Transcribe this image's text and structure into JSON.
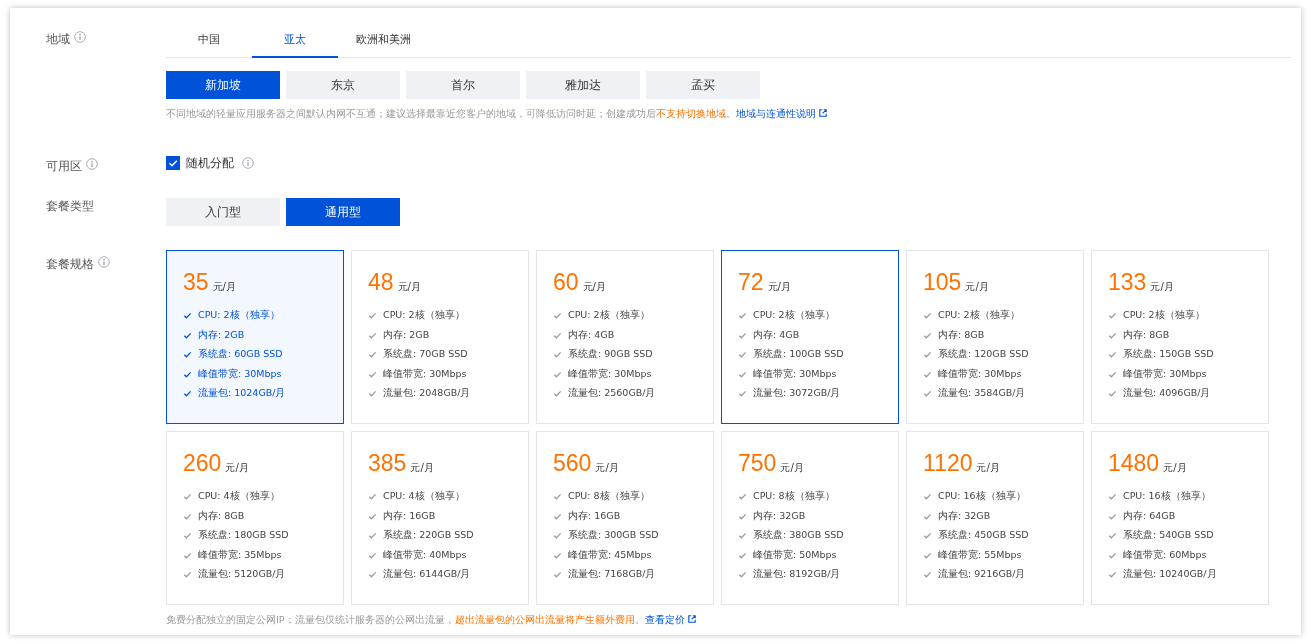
{
  "region": {
    "label": "地域",
    "tabs": [
      {
        "label": "中国",
        "selected": false
      },
      {
        "label": "亚太",
        "selected": true
      },
      {
        "label": "欧洲和美洲",
        "selected": false
      }
    ],
    "cities": [
      {
        "label": "新加坡",
        "selected": true
      },
      {
        "label": "东京",
        "selected": false
      },
      {
        "label": "首尔",
        "selected": false
      },
      {
        "label": "雅加达",
        "selected": false
      },
      {
        "label": "孟买",
        "selected": false
      }
    ],
    "hint": "不同地域的轻量应用服务器之间默认内网不互通；建议选择最靠近您客户的地域，可降低访问时延；创建成功后",
    "hint_warning": "不支持切换地域",
    "hint_sep": "。",
    "hint_link": "地域与连通性说明"
  },
  "zone": {
    "label": "可用区",
    "option": "随机分配",
    "checked": true
  },
  "package_type": {
    "label": "套餐类型",
    "options": [
      {
        "label": "入门型",
        "selected": false
      },
      {
        "label": "通用型",
        "selected": true
      }
    ]
  },
  "spec": {
    "label": "套餐规格",
    "cards": [
      {
        "price": "35",
        "unit": "元/月",
        "selected": true,
        "outlined": true,
        "features": [
          "CPU: 2核（独享）",
          "内存: 2GB",
          "系统盘: 60GB SSD",
          "峰值带宽: 30Mbps",
          "流量包: 1024GB/月"
        ]
      },
      {
        "price": "48",
        "unit": "元/月",
        "selected": false,
        "outlined": false,
        "features": [
          "CPU: 2核（独享）",
          "内存: 2GB",
          "系统盘: 70GB SSD",
          "峰值带宽: 30Mbps",
          "流量包: 2048GB/月"
        ]
      },
      {
        "price": "60",
        "unit": "元/月",
        "selected": false,
        "outlined": false,
        "features": [
          "CPU: 2核（独享）",
          "内存: 4GB",
          "系统盘: 90GB SSD",
          "峰值带宽: 30Mbps",
          "流量包: 2560GB/月"
        ]
      },
      {
        "price": "72",
        "unit": "元/月",
        "selected": false,
        "outlined": true,
        "features": [
          "CPU: 2核（独享）",
          "内存: 4GB",
          "系统盘: 100GB SSD",
          "峰值带宽: 30Mbps",
          "流量包: 3072GB/月"
        ]
      },
      {
        "price": "105",
        "unit": "元/月",
        "selected": false,
        "outlined": false,
        "features": [
          "CPU: 2核（独享）",
          "内存: 8GB",
          "系统盘: 120GB SSD",
          "峰值带宽: 30Mbps",
          "流量包: 3584GB/月"
        ]
      },
      {
        "price": "133",
        "unit": "元/月",
        "selected": false,
        "outlined": false,
        "features": [
          "CPU: 2核（独享）",
          "内存: 8GB",
          "系统盘: 150GB SSD",
          "峰值带宽: 30Mbps",
          "流量包: 4096GB/月"
        ]
      },
      {
        "price": "260",
        "unit": "元/月",
        "selected": false,
        "outlined": false,
        "features": [
          "CPU: 4核（独享）",
          "内存: 8GB",
          "系统盘: 180GB SSD",
          "峰值带宽: 35Mbps",
          "流量包: 5120GB/月"
        ]
      },
      {
        "price": "385",
        "unit": "元/月",
        "selected": false,
        "outlined": false,
        "features": [
          "CPU: 4核（独享）",
          "内存: 16GB",
          "系统盘: 220GB SSD",
          "峰值带宽: 40Mbps",
          "流量包: 6144GB/月"
        ]
      },
      {
        "price": "560",
        "unit": "元/月",
        "selected": false,
        "outlined": false,
        "features": [
          "CPU: 8核（独享）",
          "内存: 16GB",
          "系统盘: 300GB SSD",
          "峰值带宽: 45Mbps",
          "流量包: 7168GB/月"
        ]
      },
      {
        "price": "750",
        "unit": "元/月",
        "selected": false,
        "outlined": false,
        "features": [
          "CPU: 8核（独享）",
          "内存: 32GB",
          "系统盘: 380GB SSD",
          "峰值带宽: 50Mbps",
          "流量包: 8192GB/月"
        ]
      },
      {
        "price": "1120",
        "unit": "元/月",
        "selected": false,
        "outlined": false,
        "features": [
          "CPU: 16核（独享）",
          "内存: 32GB",
          "系统盘: 450GB SSD",
          "峰值带宽: 55Mbps",
          "流量包: 9216GB/月"
        ]
      },
      {
        "price": "1480",
        "unit": "元/月",
        "selected": false,
        "outlined": false,
        "features": [
          "CPU: 16核（独享）",
          "内存: 64GB",
          "系统盘: 540GB SSD",
          "峰值带宽: 60Mbps",
          "流量包: 10240GB/月"
        ]
      }
    ],
    "note": "免费分配独立的固定公网IP；流量包仅统计服务器的公网出流量，",
    "note_warning": "超出流量包的公网出流量将产生额外费用",
    "note_sep": "。",
    "note_link": "查看定价"
  }
}
